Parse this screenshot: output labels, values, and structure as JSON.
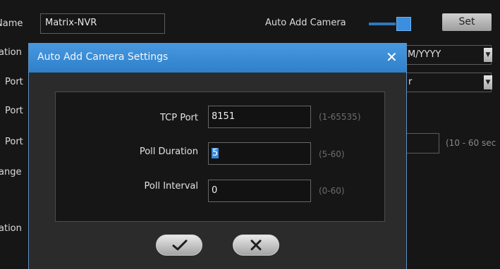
{
  "background": {
    "name_label": "Name",
    "name_value": "Matrix-NVR",
    "auto_add_label": "Auto Add Camera",
    "set_button": "Set",
    "date_format_value": "M/YYYY",
    "row_labels": [
      "ation",
      "Port",
      "Port",
      "Port",
      "ange",
      "ation"
    ],
    "select2_value": "r",
    "duration_hint": "(10 - 60 sec",
    "auto_add_enabled": true
  },
  "dialog": {
    "title": "Auto Add Camera Settings",
    "fields": [
      {
        "label": "TCP Port",
        "value": "8151",
        "range": "(1-65535)"
      },
      {
        "label": "Poll Duration",
        "value": "5",
        "range": "(5-60)"
      },
      {
        "label": "Poll Interval",
        "value": "0",
        "range": "(0-60)"
      }
    ]
  },
  "icons": {
    "close": "close-icon",
    "ok": "checkmark-icon",
    "cancel": "cancel-x-icon",
    "dropdown": "chevron-down-icon"
  },
  "colors": {
    "titlebar": "#3f8fd8",
    "accent": "#3b87d8",
    "background": "#161616"
  }
}
